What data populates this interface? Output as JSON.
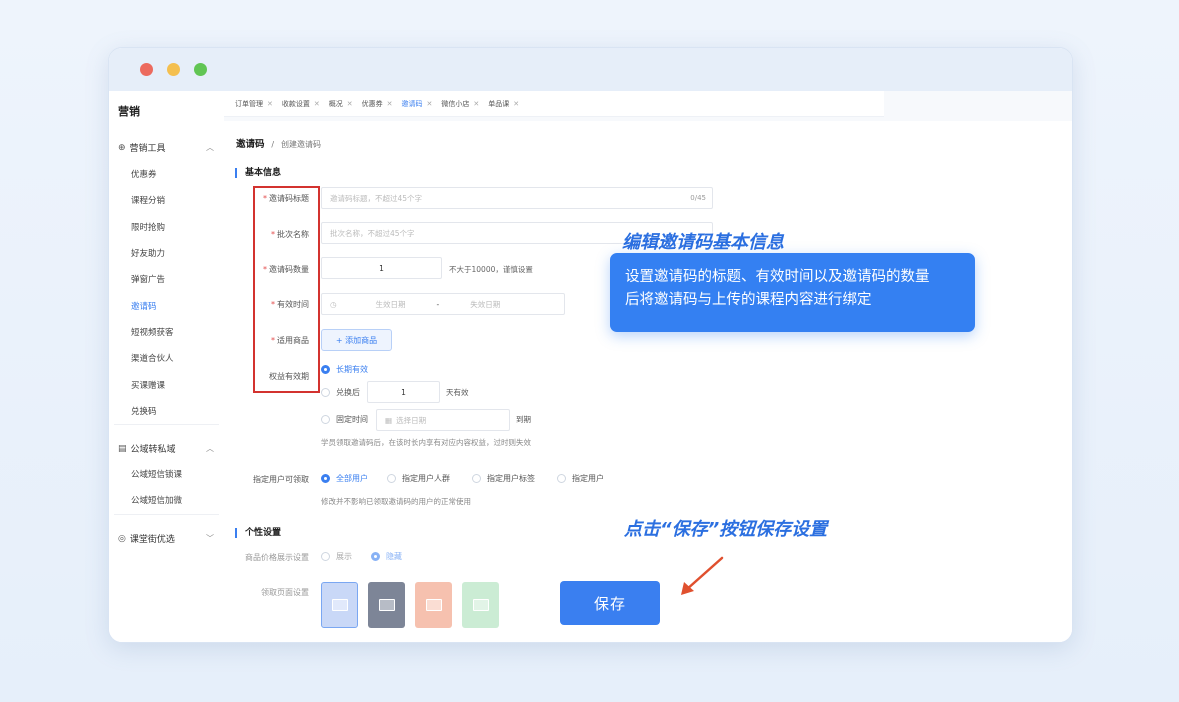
{
  "window": {
    "controls": [
      "close",
      "minimize",
      "maximize"
    ]
  },
  "sidebar": {
    "title": "营销",
    "group1": {
      "label": "营销工具",
      "icon": "gift-icon"
    },
    "items": [
      "优惠券",
      "课程分销",
      "限时抢购",
      "好友助力",
      "弹窗广告",
      "邀请码",
      "短视频获客",
      "渠道合伙人",
      "买课赠课",
      "兑换码"
    ],
    "active_index": 5,
    "group2": {
      "label": "公域转私域",
      "icon": "calendar-icon"
    },
    "items2": [
      "公域短信锁课",
      "公域短信加微"
    ],
    "group3": {
      "label": "课堂街优选",
      "icon": "location-icon"
    }
  },
  "tabs": [
    {
      "label": "订单管理",
      "active": false
    },
    {
      "label": "收款设置",
      "active": false
    },
    {
      "label": "概况",
      "active": false
    },
    {
      "label": "优惠券",
      "active": false
    },
    {
      "label": "邀请码",
      "active": true
    },
    {
      "label": "微信小店",
      "active": false
    },
    {
      "label": "单品课",
      "active": false
    }
  ],
  "breadcrumb": {
    "parent": "邀请码",
    "separator": "/",
    "current": "创建邀请码"
  },
  "basic": {
    "title": "基本信息",
    "fields": {
      "code_title": {
        "label": "邀请码标题",
        "placeholder": "邀请码标题，不超过45个字",
        "counter": "0/45"
      },
      "batch_name": {
        "label": "批次名称",
        "placeholder": "批次名称，不超过45个字"
      },
      "code_count": {
        "label": "邀请码数量",
        "value": "1",
        "hint": "不大于10000，谨慎设置"
      },
      "valid_time": {
        "label": "有效时间",
        "start": "生效日期",
        "sep": "-",
        "end": "失效日期"
      },
      "goods": {
        "label": "适用商品",
        "button": "+ 添加商品"
      },
      "rights": {
        "label": "权益有效期",
        "opt1": "长期有效",
        "opt2": "兑换后",
        "opt2_value": "1",
        "opt2_suffix": "天有效",
        "opt3": "固定时间",
        "opt3_placeholder": "选择日期",
        "opt3_suffix": "到期",
        "hint": "学员领取邀请码后，在该时长内享有对应内容权益，过时则失效"
      },
      "users": {
        "label": "指定用户可领取",
        "options": [
          "全部用户",
          "指定用户人群",
          "指定用户标签",
          "指定用户"
        ],
        "hint": "修改并不影响已领取邀请码的用户的正常使用"
      }
    }
  },
  "personal": {
    "title": "个性设置",
    "price_label": "商品价格展示设置",
    "price_options": [
      "展示",
      "隐藏"
    ],
    "page_label": "领取页面设置",
    "thumb_colors": [
      "#c9d8f7",
      "#7d8597",
      "#f3a88e",
      "#a9e0b8"
    ]
  },
  "save_label": "保存",
  "callout1": {
    "title": "编辑邀请码基本信息",
    "line1": "设置邀请码的标题、有效时间以及邀请码的数量",
    "line2": "后将邀请码与上传的课程内容进行绑定"
  },
  "callout2": "点击“保存”按钮保存设置",
  "colors": {
    "accent": "#3a7ff0",
    "highlight_box": "#d3322f",
    "arrow": "#e0502e"
  }
}
